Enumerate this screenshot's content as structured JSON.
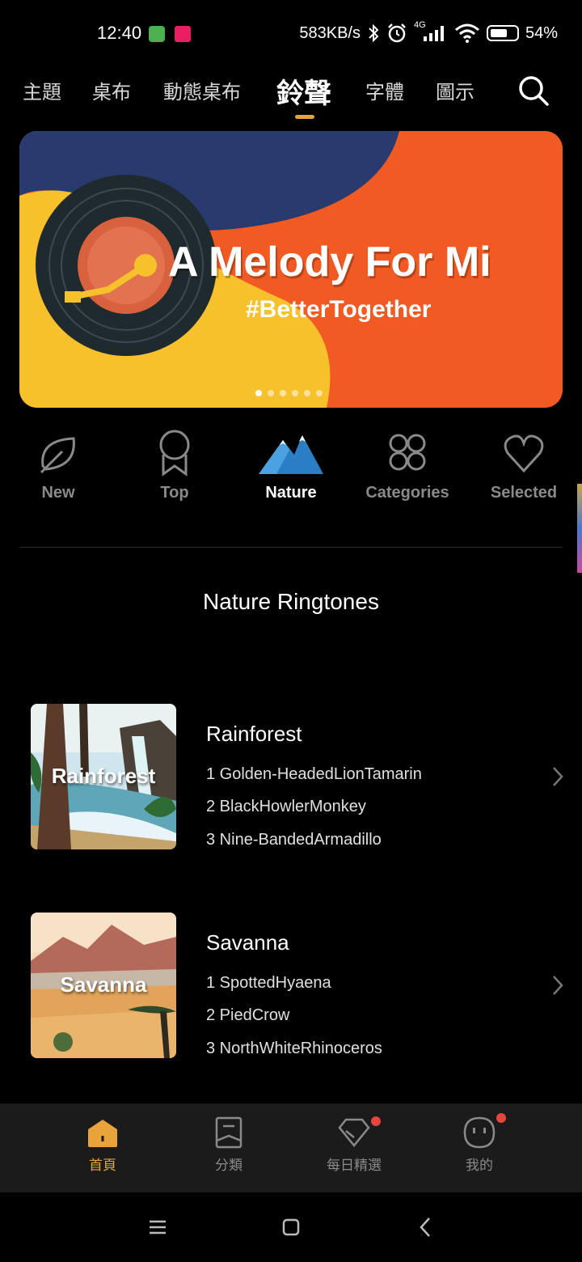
{
  "status": {
    "time": "12:40",
    "speed": "583KB/s",
    "network": "4G",
    "battery": "54%"
  },
  "top_tabs": [
    {
      "label": "主題"
    },
    {
      "label": "桌布"
    },
    {
      "label": "動態桌布"
    },
    {
      "label": "鈴聲",
      "active": true
    },
    {
      "label": "字體"
    },
    {
      "label": "圖示"
    }
  ],
  "banner": {
    "title": "A Melody For Mi",
    "subtitle": "#BetterTogether",
    "slide_count": 6,
    "active_slide": 1
  },
  "categories": [
    {
      "label": "New",
      "icon": "leaf-icon"
    },
    {
      "label": "Top",
      "icon": "medal-icon"
    },
    {
      "label": "Nature",
      "icon": "mountain-icon",
      "active": true
    },
    {
      "label": "Categories",
      "icon": "grid-icon"
    },
    {
      "label": "Selected",
      "icon": "heart-icon"
    }
  ],
  "section_title": "Nature Ringtones",
  "items": [
    {
      "thumb_label": "Rainforest",
      "title": "Rainforest",
      "tracks": [
        "1 Golden-HeadedLionTamarin",
        "2 BlackHowlerMonkey",
        "3 Nine-BandedArmadillo"
      ]
    },
    {
      "thumb_label": "Savanna",
      "title": "Savanna",
      "tracks": [
        "1 SpottedHyaena",
        "2 PiedCrow",
        "3 NorthWhiteRhinoceros"
      ]
    }
  ],
  "bottom_nav": [
    {
      "label": "首頁",
      "icon": "home-icon",
      "active": true
    },
    {
      "label": "分類",
      "icon": "bookmark-icon"
    },
    {
      "label": "每日精選",
      "icon": "diamond-icon",
      "badge": true
    },
    {
      "label": "我的",
      "icon": "profile-face-icon",
      "badge": true
    }
  ],
  "colors": {
    "accent": "#e8a33a",
    "banner_orange": "#f15a22",
    "banner_yellow": "#f7c12b",
    "banner_navy": "#283a6e",
    "badge": "#e8453c"
  }
}
